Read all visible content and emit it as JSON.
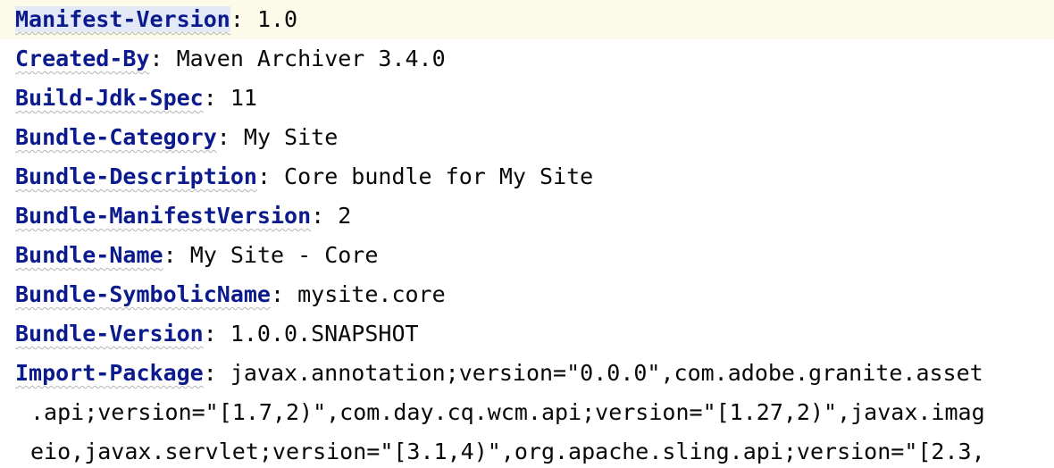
{
  "editor": {
    "lines": [
      {
        "key": "Manifest-Version",
        "sep": ": ",
        "value": "1.0"
      },
      {
        "key": "Created-By",
        "sep": ": ",
        "value": "Maven Archiver 3.4.0"
      },
      {
        "key": "Build-Jdk-Spec",
        "sep": ": ",
        "value": "11"
      },
      {
        "key": "Bundle-Category",
        "sep": ": ",
        "value": "My Site"
      },
      {
        "key": "Bundle-Description",
        "sep": ": ",
        "value": "Core bundle for My Site"
      },
      {
        "key": "Bundle-ManifestVersion",
        "sep": ": ",
        "value": "2"
      },
      {
        "key": "Bundle-Name",
        "sep": ": ",
        "value": "My Site - Core"
      },
      {
        "key": "Bundle-SymbolicName",
        "sep": ": ",
        "value": "mysite.core"
      },
      {
        "key": "Bundle-Version",
        "sep": ": ",
        "value": "1.0.0.SNAPSHOT"
      },
      {
        "key": "Import-Package",
        "sep": ": ",
        "value": "javax.annotation;version=\"0.0.0\",com.adobe.granite.asset"
      }
    ],
    "continuation_lines": [
      ".api;version=\"[1.7,2)\",com.day.cq.wcm.api;version=\"[1.27,2)\",javax.imag",
      "eio,javax.servlet;version=\"[3.1,4)\",org.apache.sling.api;version=\"[2.3,"
    ]
  },
  "colors": {
    "key": "#0b1a8c",
    "text": "#080808",
    "current_line": "#fcfae8",
    "key_highlight": "#e4e9f7",
    "background": "#ffffff"
  }
}
